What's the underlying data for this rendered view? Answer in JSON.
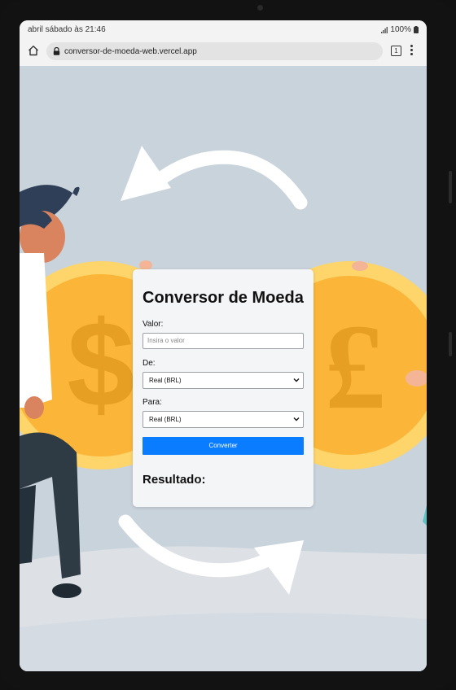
{
  "status_bar": {
    "time": "abril sábado às 21:46",
    "battery": "100%"
  },
  "browser": {
    "url": "conversor-de-moeda-web.vercel.app",
    "tab_count": "1"
  },
  "colors": {
    "page_background": "#c9d3dc",
    "card_background": "#f4f5f7",
    "button": "#0a7cff",
    "coin": "#fbb63a"
  },
  "form": {
    "title": "Conversor de Moeda",
    "valor_label": "Valor:",
    "valor_placeholder": "Insira o valor",
    "de_label": "De:",
    "de_selected": "Real (BRL)",
    "para_label": "Para:",
    "para_selected": "Real (BRL)",
    "convert_button": "Converter",
    "result_label": "Resultado:"
  }
}
